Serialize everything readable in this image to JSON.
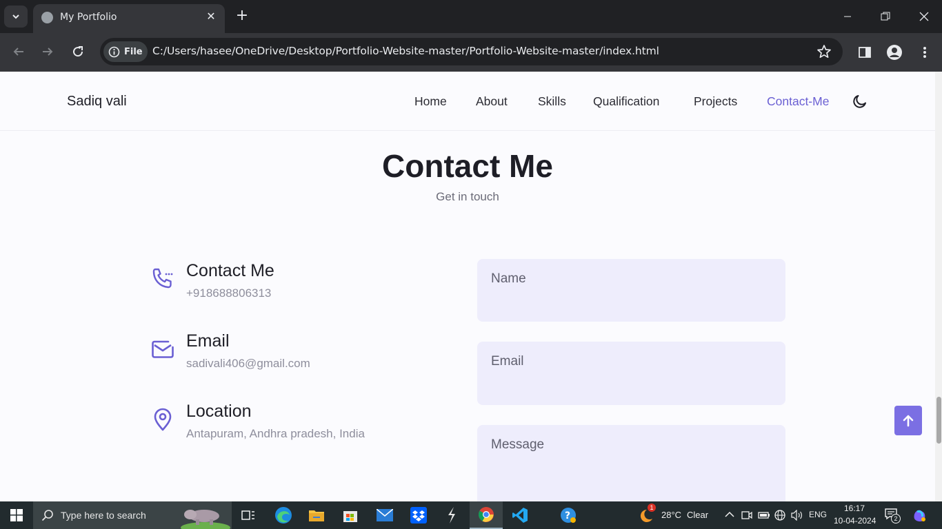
{
  "browser": {
    "tab_title": "My Portfolio",
    "site_chip": "File",
    "url": "C:/Users/hasee/OneDrive/Desktop/Portfolio-Website-master/Portfolio-Website-master/index.html"
  },
  "header": {
    "logo": "Sadiq vali",
    "nav": [
      {
        "label": "Home",
        "active": false
      },
      {
        "label": "About",
        "active": false
      },
      {
        "label": "Skills",
        "active": false
      },
      {
        "label": "Qualification",
        "active": false
      },
      {
        "label": "Projects",
        "active": false
      },
      {
        "label": "Contact-Me",
        "active": true
      }
    ],
    "theme_icon": "moon-icon"
  },
  "contact": {
    "title": "Contact Me",
    "subtitle": "Get in touch",
    "info": [
      {
        "icon": "phone-icon",
        "title": "Contact Me",
        "value": "+918688806313"
      },
      {
        "icon": "mail-icon",
        "title": "Email",
        "value": "sadivali406@gmail.com"
      },
      {
        "icon": "location-pin-icon",
        "title": "Location",
        "value": "Antapuram, Andhra pradesh, India"
      }
    ],
    "form": {
      "name_label": "Name",
      "email_label": "Email",
      "message_label": "Message"
    }
  },
  "taskbar": {
    "search_placeholder": "Type here to search",
    "weather_temp": "28°C",
    "weather_condition": "Clear",
    "weather_badge": "1",
    "language": "ENG",
    "time": "16:17",
    "date": "10-04-2024",
    "notification_count": "2"
  },
  "colors": {
    "accent": "#6a5fd3",
    "field_bg": "#eeedfc",
    "page_bg": "#fbfbfe"
  }
}
